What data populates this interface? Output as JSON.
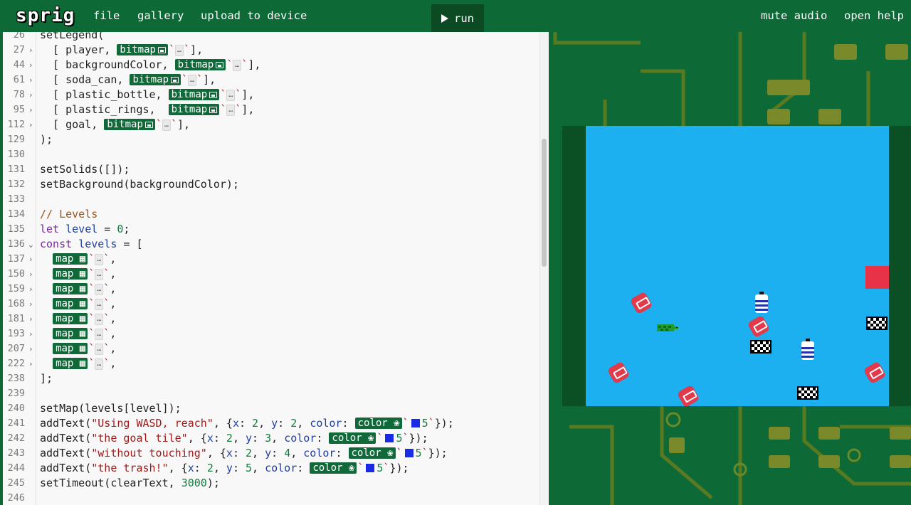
{
  "nav": {
    "logo": "sprig",
    "file": "file",
    "gallery": "gallery",
    "upload": "upload to device",
    "run": "run",
    "mute": "mute audio",
    "help": "open help"
  },
  "colors": {
    "background": "#0d6a36",
    "editor_bg": "#f8f8f8",
    "pill": "#11693a",
    "game_water": "#1cb0f1",
    "goal": "#e83247",
    "swatch": "#1a2be6"
  },
  "pill_labels": {
    "bitmap": "bitmap",
    "map": "map",
    "color": "color",
    "ellipsis": "…"
  },
  "code": {
    "lines": [
      {
        "n": "26",
        "fold": false,
        "text": "setLegend("
      },
      {
        "n": "27",
        "fold": true,
        "text": "  [ player, ",
        "after": "],"
      },
      {
        "n": "44",
        "fold": true,
        "text": "  [ backgroundColor, ",
        "after": "],"
      },
      {
        "n": "61",
        "fold": true,
        "text": "  [ soda_can, ",
        "after": "],"
      },
      {
        "n": "78",
        "fold": true,
        "text": "  [ plastic_bottle, ",
        "after": "],"
      },
      {
        "n": "95",
        "fold": true,
        "text": "  [ plastic_rings,  ",
        "after": "],"
      },
      {
        "n": "112",
        "fold": true,
        "text": "  [ goal, ",
        "after": "],"
      },
      {
        "n": "129",
        "fold": false,
        "text": ");"
      },
      {
        "n": "130",
        "fold": false,
        "text": ""
      },
      {
        "n": "131",
        "fold": false,
        "text": "setSolids([]);"
      },
      {
        "n": "132",
        "fold": false,
        "text": "setBackground(backgroundColor);"
      },
      {
        "n": "133",
        "fold": false,
        "text": ""
      },
      {
        "n": "134",
        "fold": false,
        "text": "// Levels"
      },
      {
        "n": "135",
        "fold": false,
        "text": "let level = 0;"
      },
      {
        "n": "136",
        "fold": true,
        "text": "const levels = ["
      },
      {
        "n": "137",
        "fold": true,
        "text": "  "
      },
      {
        "n": "150",
        "fold": true,
        "text": "  "
      },
      {
        "n": "159",
        "fold": true,
        "text": "  "
      },
      {
        "n": "168",
        "fold": true,
        "text": "  "
      },
      {
        "n": "181",
        "fold": true,
        "text": "  "
      },
      {
        "n": "193",
        "fold": true,
        "text": "  "
      },
      {
        "n": "207",
        "fold": true,
        "text": "  "
      },
      {
        "n": "222",
        "fold": true,
        "text": "  "
      },
      {
        "n": "238",
        "fold": false,
        "text": "];"
      },
      {
        "n": "239",
        "fold": false,
        "text": ""
      },
      {
        "n": "240",
        "fold": false,
        "text": "setMap(levels[level]);"
      },
      {
        "n": "241",
        "fold": false,
        "text": "addText(\"Using WASD, reach\", {x: 2, y: 2, color: "
      },
      {
        "n": "242",
        "fold": false,
        "text": "addText(\"the goal tile\", {x: 2, y: 3, color: "
      },
      {
        "n": "243",
        "fold": false,
        "text": "addText(\"without touching\", {x: 2, y: 4, color: "
      },
      {
        "n": "244",
        "fold": false,
        "text": "addText(\"the trash!\", {x: 2, y: 5, color: "
      },
      {
        "n": "245",
        "fold": false,
        "text": "setTimeout(clearText, 3000);"
      },
      {
        "n": "246",
        "fold": false,
        "text": ""
      }
    ],
    "color_value": "5",
    "comment": "// Levels",
    "kw_let": "let",
    "kw_const": "const",
    "var_level": "level",
    "var_levels": "levels",
    "num_zero": "0",
    "text_args": [
      {
        "str": "\"Using WASD, reach\"",
        "x": "2",
        "y": "2"
      },
      {
        "str": "\"the goal tile\"",
        "x": "2",
        "y": "3"
      },
      {
        "str": "\"without touching\"",
        "x": "2",
        "y": "4"
      },
      {
        "str": "\"the trash!\"",
        "x": "2",
        "y": "5"
      }
    ],
    "timeout": "3000"
  },
  "game": {
    "sprites": [
      "player",
      "soda_can",
      "plastic_bottle",
      "plastic_rings",
      "goal"
    ]
  }
}
